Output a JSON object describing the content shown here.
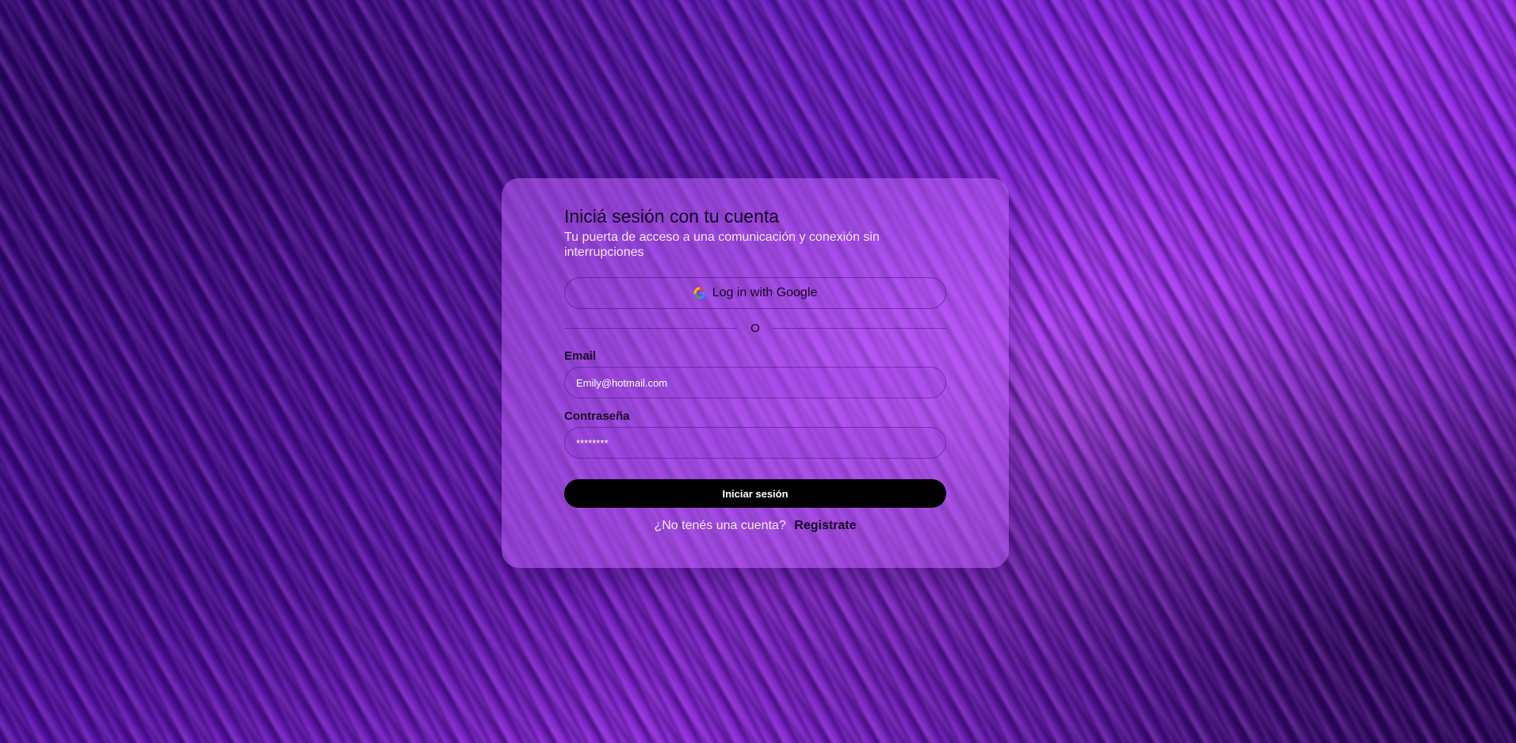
{
  "login": {
    "title": "Iniciá sesión con tu cuenta",
    "subtitle": "Tu puerta de acceso a una comunicación y conexión sin interrupciones",
    "google_button_label": "Log in with Google",
    "google_icon": "google-icon",
    "divider_text": "O",
    "email_label": "Email",
    "email_value": "Emily@hotmail.com",
    "password_label": "Contraseña",
    "password_value": "********",
    "submit_label": "Iniciar sesión",
    "signup_question": "¿No tenés una cuenta?",
    "signup_link": "Registrate"
  },
  "colors": {
    "background": "#7a1fd0",
    "card": "#b95ff5",
    "primary_button": "#000000",
    "primary_button_text": "#ffffff"
  }
}
